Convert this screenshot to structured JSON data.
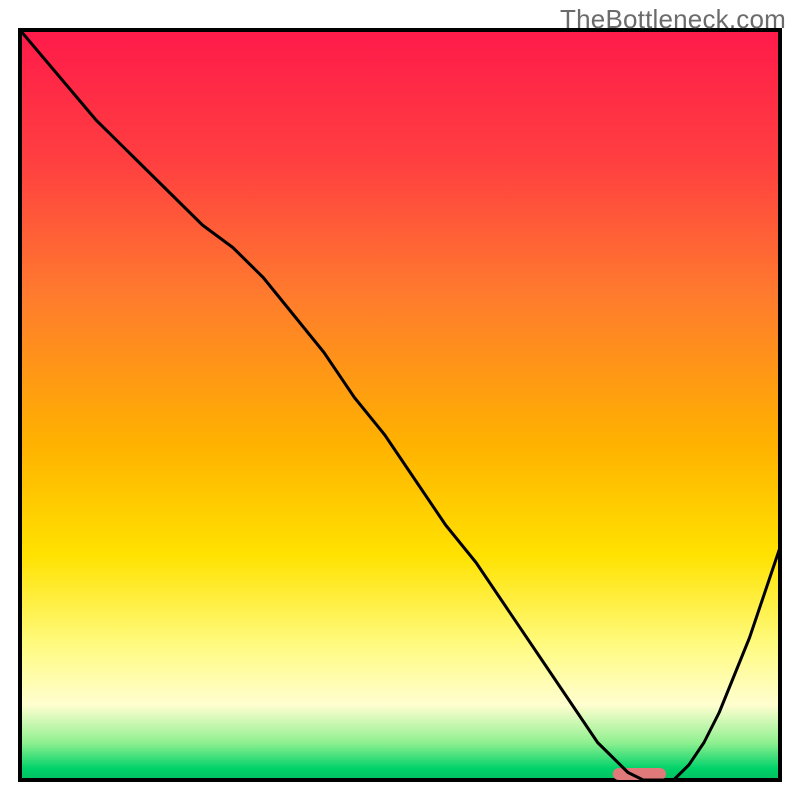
{
  "watermark": "TheBottleneck.com",
  "chart_data": {
    "type": "line",
    "title": "",
    "xlabel": "",
    "ylabel": "",
    "xlim": [
      0,
      100
    ],
    "ylim": [
      0,
      100
    ],
    "grid": false,
    "background_gradient_stops": [
      {
        "offset": 0.0,
        "color": "#ff1a4a"
      },
      {
        "offset": 0.18,
        "color": "#ff4040"
      },
      {
        "offset": 0.35,
        "color": "#ff7a2e"
      },
      {
        "offset": 0.55,
        "color": "#ffb100"
      },
      {
        "offset": 0.7,
        "color": "#ffe200"
      },
      {
        "offset": 0.82,
        "color": "#fffb80"
      },
      {
        "offset": 0.9,
        "color": "#fffed0"
      },
      {
        "offset": 0.95,
        "color": "#90f090"
      },
      {
        "offset": 0.985,
        "color": "#00d26a"
      },
      {
        "offset": 1.0,
        "color": "#00c060"
      }
    ],
    "series": [
      {
        "name": "bottleneck-curve",
        "color": "#000000",
        "stroke_width": 3,
        "x": [
          0,
          5,
          10,
          15,
          20,
          24,
          28,
          32,
          36,
          40,
          44,
          48,
          52,
          56,
          60,
          64,
          68,
          72,
          74,
          76,
          78,
          80,
          82,
          84,
          86,
          88,
          90,
          92,
          94,
          96,
          98,
          100
        ],
        "y": [
          100,
          94,
          88,
          83,
          78,
          74,
          71,
          67,
          62,
          57,
          51,
          46,
          40,
          34,
          29,
          23,
          17,
          11,
          8,
          5,
          3,
          1,
          0,
          0,
          0,
          2,
          5,
          9,
          14,
          19,
          25,
          31
        ]
      }
    ],
    "annotations": [
      {
        "name": "highlight-bar",
        "shape": "rounded-rect",
        "color": "#e07a7a",
        "x_start": 78,
        "x_end": 85,
        "y": 0,
        "height_pct": 1.6
      }
    ]
  }
}
